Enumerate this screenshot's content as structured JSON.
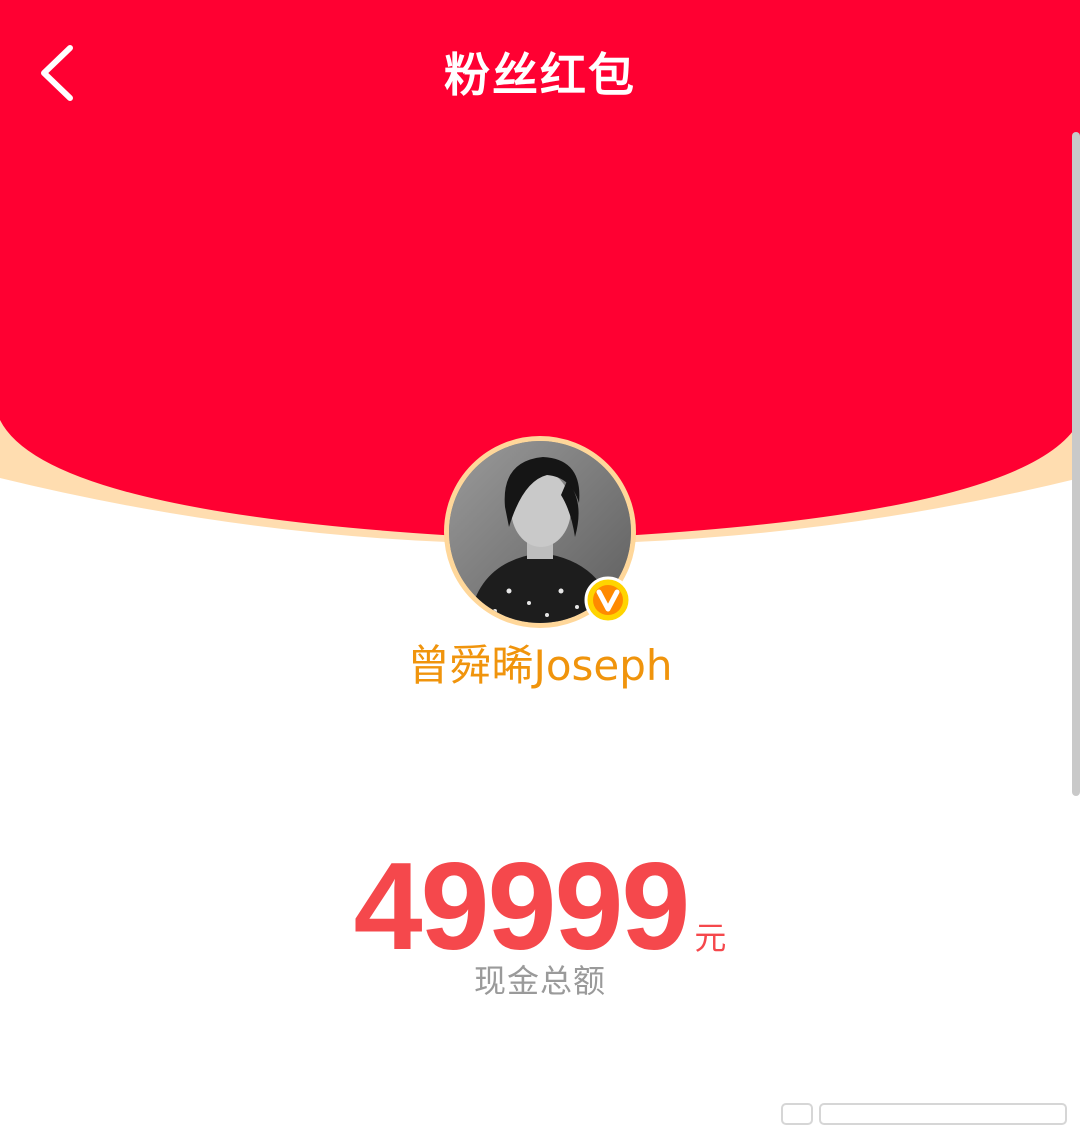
{
  "header": {
    "title": "粉丝红包",
    "back_icon": "chevron-left-icon"
  },
  "colors": {
    "envelope_red": "#ff0032",
    "envelope_rim": "#ffddb0",
    "name_orange": "#f0940c",
    "amount_red": "#f5484c",
    "caption_gray": "#9a9a9a"
  },
  "profile": {
    "name": "曾舜晞Joseph",
    "avatar_alt": "avatar",
    "badge_icon": "verified-v-badge-icon"
  },
  "amount": {
    "value": "49999",
    "unit": "元",
    "caption": "现金总额"
  }
}
